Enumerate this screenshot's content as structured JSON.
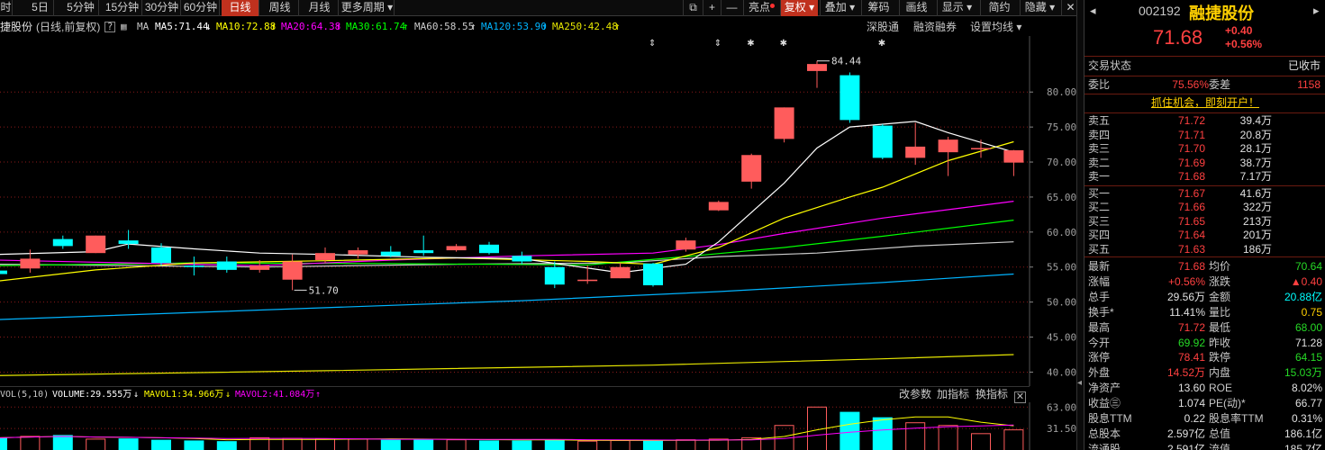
{
  "toolbar": {
    "periods": [
      "时",
      "5日",
      "5分钟",
      "15分钟",
      "30分钟",
      "60分钟",
      "日线",
      "周线",
      "月线",
      "更多周期"
    ],
    "active_period": "日线",
    "tools": {
      "highlight": "亮点",
      "restore": "复权",
      "overlay": "叠加",
      "chips": "筹码",
      "draw": "画线",
      "display": "显示",
      "pricing": "简约",
      "hide": "隐藏"
    }
  },
  "indicator_row": {
    "stock_label": "捷股份",
    "mode": "(日线,前复权)",
    "ma_label": "MA",
    "ma5": "MA5:71.44",
    "ma10": "MA10:72.88",
    "ma20": "MA20:64.38",
    "ma30": "MA30:61.74",
    "ma60": "MA60:58.55",
    "ma120": "MA120:53.90",
    "ma250": "MA250:42.48",
    "links": [
      "深股通",
      "融资融券",
      "设置均线"
    ]
  },
  "price_annotations": {
    "high": "84.44",
    "low": "51.70"
  },
  "volume_row": {
    "label": "VOL(5,10)",
    "volume": "VOLUME:29.555万",
    "mavol1": "MAVOL1:34.966万",
    "mavol2": "MAVOL2:41.084万",
    "links": [
      "改参数",
      "加指标",
      "换指标"
    ],
    "axis": [
      "63.00",
      "31.50"
    ]
  },
  "colors": {
    "up": "#ff5c5c",
    "down": "#00ffff",
    "ma5": "#ffffff",
    "ma10": "#ffff00",
    "ma20": "#ff00ff",
    "ma30": "#00ff00",
    "ma60": "#cccccc",
    "ma120": "#00b4ff",
    "ma250": "#e6e600",
    "grid": "#8b1a1a"
  },
  "chart_data": {
    "type": "candlestick",
    "ylim": [
      38,
      88
    ],
    "y_ticks": [
      "80.00",
      "75.00",
      "70.00",
      "65.00",
      "60.00",
      "55.00",
      "50.00",
      "45.00",
      "40.00"
    ],
    "candles": [
      {
        "o": 54.5,
        "c": 54.0,
        "h": 55.5,
        "l": 53.5
      },
      {
        "o": 54.8,
        "c": 56.2,
        "h": 57.5,
        "l": 54.2
      },
      {
        "o": 59.0,
        "c": 58.0,
        "h": 59.5,
        "l": 57.6
      },
      {
        "o": 57.0,
        "c": 59.5,
        "h": 59.5,
        "l": 57.0
      },
      {
        "o": 58.8,
        "c": 58.3,
        "h": 60.3,
        "l": 57.6
      },
      {
        "o": 57.8,
        "c": 55.6,
        "h": 58.4,
        "l": 55.2
      },
      {
        "o": 55.2,
        "c": 55.0,
        "h": 56.5,
        "l": 53.8
      },
      {
        "o": 55.8,
        "c": 54.6,
        "h": 56.5,
        "l": 54.2
      },
      {
        "o": 54.6,
        "c": 55.2,
        "h": 56.0,
        "l": 54.2
      },
      {
        "o": 53.2,
        "c": 55.8,
        "h": 56.8,
        "l": 51.7
      },
      {
        "o": 56.0,
        "c": 57.0,
        "h": 57.8,
        "l": 55.6
      },
      {
        "o": 56.8,
        "c": 57.4,
        "h": 57.8,
        "l": 56.2
      },
      {
        "o": 57.2,
        "c": 56.6,
        "h": 58.0,
        "l": 56.4
      },
      {
        "o": 57.4,
        "c": 57.0,
        "h": 59.5,
        "l": 56.6
      },
      {
        "o": 57.4,
        "c": 58.0,
        "h": 58.3,
        "l": 57.2
      },
      {
        "o": 58.2,
        "c": 57.0,
        "h": 58.6,
        "l": 56.8
      },
      {
        "o": 56.6,
        "c": 55.8,
        "h": 57.2,
        "l": 55.4
      },
      {
        "o": 55.0,
        "c": 52.5,
        "h": 55.8,
        "l": 52.0
      },
      {
        "o": 53.0,
        "c": 53.2,
        "h": 55.2,
        "l": 52.6
      },
      {
        "o": 53.4,
        "c": 55.0,
        "h": 55.6,
        "l": 53.4
      },
      {
        "o": 55.5,
        "c": 52.4,
        "h": 55.6,
        "l": 52.2
      },
      {
        "o": 57.5,
        "c": 58.8,
        "h": 59.2,
        "l": 57.2
      },
      {
        "o": 63.1,
        "c": 64.3,
        "h": 64.5,
        "l": 63.0
      },
      {
        "o": 67.2,
        "c": 71.0,
        "h": 71.2,
        "l": 66.2
      },
      {
        "o": 73.3,
        "c": 77.8,
        "h": 77.8,
        "l": 72.8
      },
      {
        "o": 83.0,
        "c": 84.0,
        "h": 84.44,
        "l": 80.6
      },
      {
        "o": 82.4,
        "c": 76.0,
        "h": 82.8,
        "l": 75.6
      },
      {
        "o": 75.2,
        "c": 70.6,
        "h": 75.4,
        "l": 70.4
      },
      {
        "o": 70.6,
        "c": 72.2,
        "h": 75.6,
        "l": 69.6
      },
      {
        "o": 71.4,
        "c": 73.2,
        "h": 73.6,
        "l": 68.0
      },
      {
        "o": 71.9,
        "c": 72.0,
        "h": 73.2,
        "l": 70.6
      },
      {
        "o": 69.92,
        "c": 71.68,
        "h": 71.72,
        "l": 68.0
      }
    ],
    "ma5": [
      [
        0,
        56.8
      ],
      [
        3,
        57.2
      ],
      [
        4,
        58.3
      ],
      [
        6,
        57.6
      ],
      [
        8,
        57.0
      ],
      [
        10,
        56.8
      ],
      [
        13,
        56.4
      ],
      [
        16,
        56.2
      ],
      [
        19,
        54.2
      ],
      [
        21,
        55.4
      ],
      [
        22,
        58.6
      ],
      [
        24,
        67.0
      ],
      [
        25,
        72.0
      ],
      [
        26,
        75.0
      ],
      [
        28,
        75.8
      ],
      [
        29,
        74.2
      ],
      [
        31,
        71.4
      ]
    ],
    "ma10": [
      [
        0,
        53.0
      ],
      [
        3,
        54.6
      ],
      [
        6,
        55.6
      ],
      [
        10,
        55.9
      ],
      [
        14,
        56.3
      ],
      [
        18,
        55.8
      ],
      [
        20,
        55.4
      ],
      [
        22,
        57.8
      ],
      [
        24,
        62.0
      ],
      [
        26,
        65.0
      ],
      [
        27,
        66.4
      ],
      [
        29,
        70.2
      ],
      [
        31,
        72.9
      ]
    ],
    "ma20": [
      [
        0,
        56.0
      ],
      [
        4,
        55.6
      ],
      [
        8,
        55.2
      ],
      [
        12,
        56.0
      ],
      [
        16,
        56.6
      ],
      [
        20,
        57.0
      ],
      [
        22,
        58.2
      ],
      [
        24,
        59.8
      ],
      [
        27,
        62.0
      ],
      [
        31,
        64.4
      ]
    ],
    "ma30": [
      [
        0,
        55.2
      ],
      [
        6,
        55.6
      ],
      [
        12,
        55.5
      ],
      [
        18,
        55.3
      ],
      [
        21,
        56.5
      ],
      [
        24,
        57.8
      ],
      [
        27,
        59.4
      ],
      [
        31,
        61.7
      ]
    ],
    "ma60": [
      [
        0,
        55.4
      ],
      [
        8,
        55.0
      ],
      [
        14,
        55.4
      ],
      [
        19,
        55.6
      ],
      [
        22,
        56.5
      ],
      [
        25,
        57.0
      ],
      [
        28,
        58.0
      ],
      [
        31,
        58.6
      ]
    ],
    "ma120": [
      [
        0,
        47.5
      ],
      [
        10,
        49.2
      ],
      [
        16,
        50.2
      ],
      [
        22,
        51.5
      ],
      [
        27,
        52.8
      ],
      [
        31,
        54.0
      ]
    ],
    "ma250": [
      [
        0,
        39.5
      ],
      [
        10,
        40.2
      ],
      [
        20,
        41.0
      ],
      [
        27,
        41.9
      ],
      [
        31,
        42.5
      ]
    ],
    "volume": [
      18,
      20,
      22,
      16,
      17,
      15,
      14,
      13,
      18,
      17,
      16,
      16,
      15,
      16,
      15,
      14,
      14,
      15,
      13,
      14,
      14,
      15,
      16,
      18,
      36,
      63,
      56,
      48,
      40,
      36,
      24,
      29.555
    ],
    "ylim_volume": [
      0,
      70
    ]
  },
  "panel": {
    "code": "002192",
    "name": "融捷股份",
    "price": "71.68",
    "change": "+0.40",
    "change_pct": "+0.56%",
    "trade_status_label": "交易状态",
    "trade_status": "已收市",
    "wb_label": "委比",
    "wb": "75.56%",
    "wc_label": "委差",
    "wc": "1158",
    "promo": "抓住机会，即刻开户！",
    "asks": [
      {
        "label": "卖五",
        "price": "71.72",
        "vol": "39.4万"
      },
      {
        "label": "卖四",
        "price": "71.71",
        "vol": "20.8万"
      },
      {
        "label": "卖三",
        "price": "71.70",
        "vol": "28.1万"
      },
      {
        "label": "卖二",
        "price": "71.69",
        "vol": "38.7万"
      },
      {
        "label": "卖一",
        "price": "71.68",
        "vol": "7.17万"
      }
    ],
    "bids": [
      {
        "label": "买一",
        "price": "71.67",
        "vol": "41.6万"
      },
      {
        "label": "买二",
        "price": "71.66",
        "vol": "322万"
      },
      {
        "label": "买三",
        "price": "71.65",
        "vol": "213万"
      },
      {
        "label": "买四",
        "price": "71.64",
        "vol": "201万"
      },
      {
        "label": "买五",
        "price": "71.63",
        "vol": "186万"
      }
    ],
    "stats": [
      {
        "l1": "最新",
        "v1": "71.68",
        "c1": "red",
        "l2": "均价",
        "v2": "70.64",
        "c2": "green"
      },
      {
        "l1": "涨幅",
        "v1": "+0.56%",
        "c1": "red",
        "l2": "涨跌",
        "v2": "▲0.40",
        "c2": "red"
      },
      {
        "l1": "总手",
        "v1": "29.56万",
        "c1": "white",
        "l2": "金额",
        "v2": "20.88亿",
        "c2": "cyan"
      },
      {
        "l1": "换手*",
        "v1": "11.41%",
        "c1": "white",
        "l2": "量比",
        "v2": "0.75",
        "c2": "yellow"
      },
      {
        "l1": "最高",
        "v1": "71.72",
        "c1": "red",
        "l2": "最低",
        "v2": "68.00",
        "c2": "green"
      },
      {
        "l1": "今开",
        "v1": "69.92",
        "c1": "green",
        "l2": "昨收",
        "v2": "71.28",
        "c2": "white"
      },
      {
        "l1": "涨停",
        "v1": "78.41",
        "c1": "red",
        "l2": "跌停",
        "v2": "64.15",
        "c2": "green"
      },
      {
        "l1": "外盘",
        "v1": "14.52万",
        "c1": "red",
        "l2": "内盘",
        "v2": "15.03万",
        "c2": "green"
      },
      {
        "l1": "净资产",
        "v1": "13.60",
        "c1": "white",
        "l2": "ROE",
        "v2": "8.02%",
        "c2": "white"
      },
      {
        "l1": "收益㊂",
        "v1": "1.074",
        "c1": "white",
        "l2": "PE(动)*",
        "v2": "66.77",
        "c2": "white"
      },
      {
        "l1": "股息TTM",
        "v1": "0.22",
        "c1": "white",
        "l2": "股息率TTM",
        "v2": "0.31%",
        "c2": "white"
      },
      {
        "l1": "总股本",
        "v1": "2.597亿",
        "c1": "white",
        "l2": "总值",
        "v2": "186.1亿",
        "c2": "white"
      },
      {
        "l1": "流通股",
        "v1": "2.591亿",
        "c1": "white",
        "l2": "流值",
        "v2": "185.7亿",
        "c2": "white"
      }
    ]
  }
}
